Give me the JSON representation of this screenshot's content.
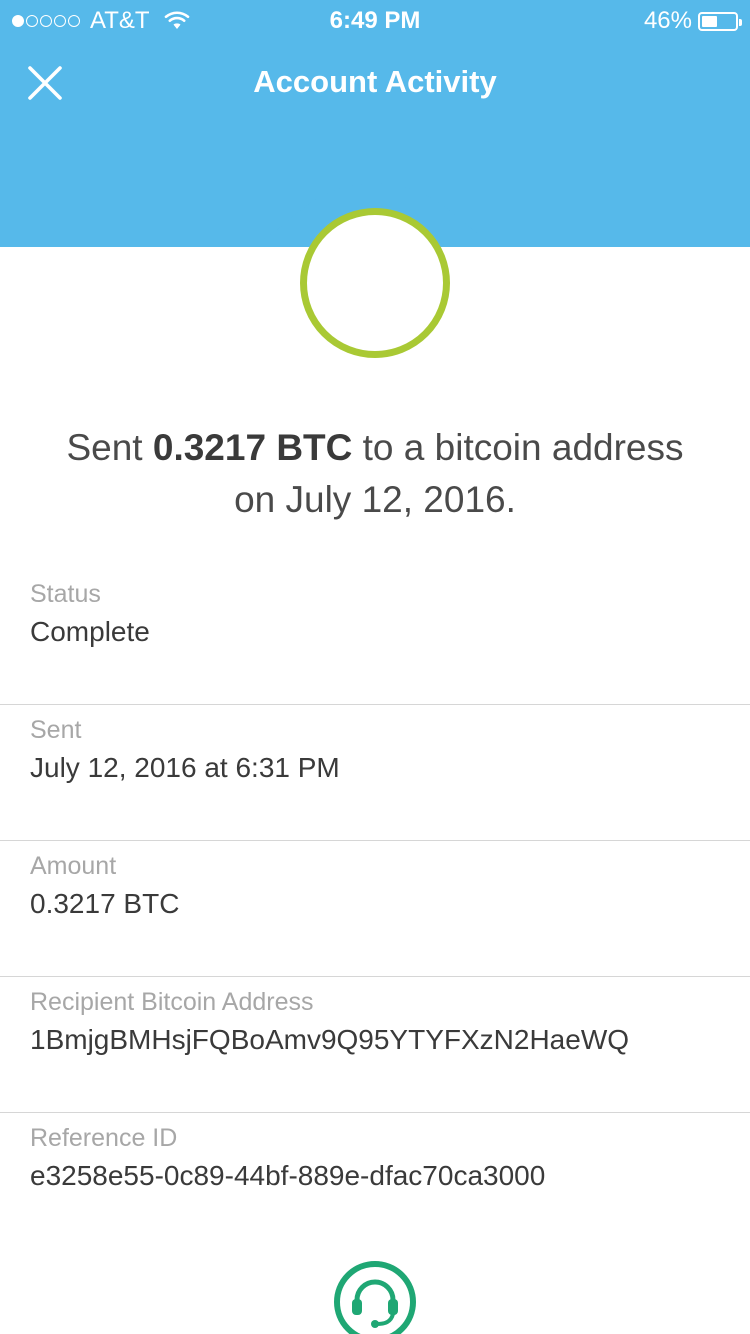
{
  "status_bar": {
    "signal_strength": 1,
    "carrier": "AT&T",
    "time": "6:49 PM",
    "battery_percent": "46%",
    "battery_level": 0.46
  },
  "header": {
    "title": "Account Activity",
    "close_icon": "close-icon",
    "background": "#56b9ea"
  },
  "transaction": {
    "status_ring_color": "#a9c934",
    "summary_prefix": "Sent ",
    "summary_amount": "0.3217 BTC",
    "summary_middle": " to a bitcoin address",
    "summary_date": "on July 12, 2016."
  },
  "details": [
    {
      "label": "Status",
      "value": "Complete"
    },
    {
      "label": "Sent",
      "value": "July 12, 2016 at 6:31 PM"
    },
    {
      "label": "Amount",
      "value": "0.3217 BTC"
    },
    {
      "label": "Recipient Bitcoin Address",
      "value": "1BmjgBMHsjFQBoAmv9Q95YTYFXzN2HaeWQ"
    },
    {
      "label": "Reference ID",
      "value": "e3258e55-0c89-44bf-889e-dfac70ca3000"
    }
  ],
  "support": {
    "icon": "headset-support-icon",
    "color": "#1fa774"
  }
}
